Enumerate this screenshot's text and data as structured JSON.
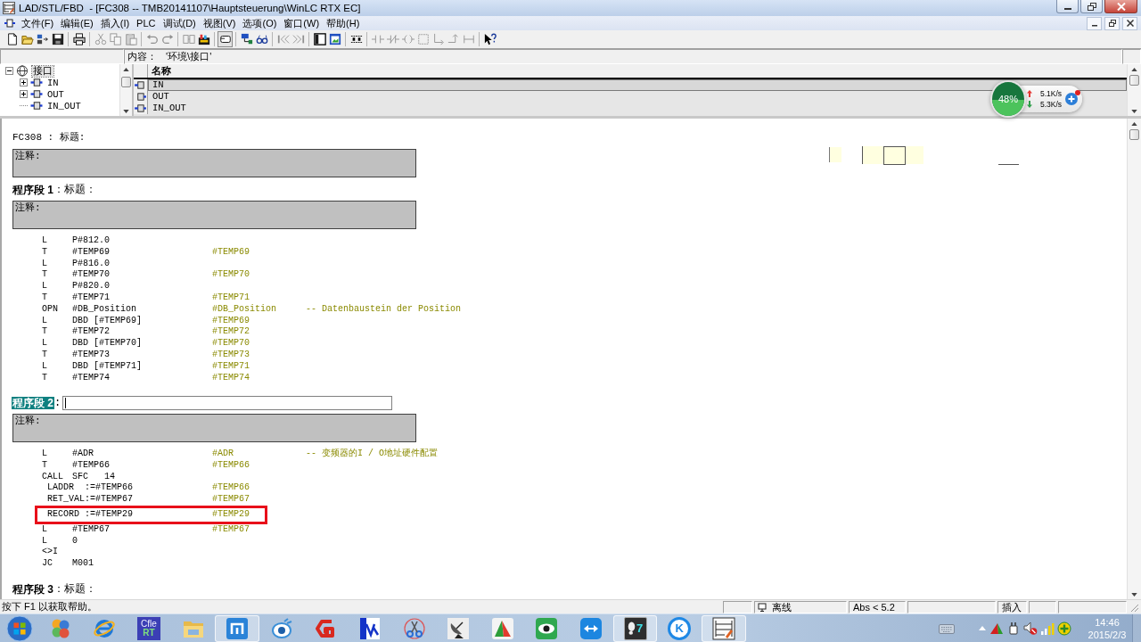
{
  "window": {
    "title": "LAD/STL/FBD  - [FC308 -- TMB20141107\\Hauptsteuerung\\WinLC RTX EC]"
  },
  "menu": [
    "文件(F)",
    "编辑(E)",
    "插入(I)",
    "PLC",
    "调试(D)",
    "视图(V)",
    "选项(O)",
    "窗口(W)",
    "帮助(H)"
  ],
  "toolbar": [
    [
      {
        "disabled": false,
        "pressed": false
      },
      {
        "disabled": false,
        "pressed": false
      },
      {
        "disabled": false,
        "pressed": false
      },
      {
        "disabled": false,
        "pressed": false
      }
    ],
    [
      {
        "disabled": false,
        "pressed": false
      }
    ],
    [
      {
        "disabled": true,
        "pressed": false
      },
      {
        "disabled": true,
        "pressed": false
      },
      {
        "disabled": true,
        "pressed": false
      }
    ],
    [
      {
        "disabled": true,
        "pressed": false
      },
      {
        "disabled": true,
        "pressed": false
      }
    ],
    [
      {
        "disabled": true,
        "pressed": false
      },
      {
        "disabled": false,
        "pressed": false
      }
    ],
    [
      {
        "disabled": false,
        "pressed": true
      }
    ],
    [
      {
        "disabled": false,
        "pressed": false
      },
      {
        "disabled": false,
        "pressed": false
      }
    ],
    [
      {
        "disabled": true,
        "pressed": false
      },
      {
        "disabled": true,
        "pressed": false
      }
    ],
    [
      {
        "disabled": false,
        "pressed": false
      },
      {
        "disabled": false,
        "pressed": false
      }
    ],
    [
      {
        "disabled": false,
        "pressed": false
      }
    ],
    [
      {
        "disabled": true,
        "pressed": false
      },
      {
        "disabled": true,
        "pressed": false
      },
      {
        "disabled": true,
        "pressed": false
      },
      {
        "disabled": true,
        "pressed": false
      },
      {
        "disabled": true,
        "pressed": false
      },
      {
        "disabled": true,
        "pressed": false
      },
      {
        "disabled": true,
        "pressed": false
      }
    ],
    [
      {
        "disabled": false,
        "pressed": false
      }
    ]
  ],
  "interface_pane": {
    "content_label": "内容：",
    "content_path": "'环境\\接口'",
    "tree": [
      {
        "label": "接口",
        "expanded": true,
        "selected": true,
        "children": [
          {
            "label": "IN",
            "expanded": false,
            "selected": false
          },
          {
            "label": "OUT",
            "expanded": false,
            "selected": false
          },
          {
            "label": "IN_OUT",
            "selected": false
          }
        ]
      }
    ],
    "table": {
      "columns": [
        "名称"
      ],
      "rows": [
        {
          "name": "IN",
          "selected": true
        },
        {
          "name": "OUT",
          "selected": false
        },
        {
          "name": "IN_OUT",
          "selected": false
        }
      ]
    }
  },
  "speed_widget": {
    "percent": "48%",
    "level": 0.48,
    "upload": "5.1K/s",
    "download": "5.3K/s",
    "notification": true
  },
  "editor": {
    "block_title": "FC308 : 标题:",
    "block_comment": "注释:",
    "networks": [
      {
        "heading": "程序段 1",
        "title": "：标题：",
        "editing": false,
        "comment": "注释:",
        "lines": [
          {
            "kind": "instr",
            "op": "L",
            "operand": "P#812.0",
            "framed": false
          },
          {
            "kind": "instr",
            "op": "T",
            "operand": "#TEMP69",
            "symbol": "#TEMP69",
            "framed": false
          },
          {
            "kind": "instr",
            "op": "L",
            "operand": "P#816.0",
            "framed": false
          },
          {
            "kind": "instr",
            "op": "T",
            "operand": "#TEMP70",
            "symbol": "#TEMP70",
            "framed": false
          },
          {
            "kind": "instr",
            "op": "L",
            "operand": "P#820.0",
            "framed": false
          },
          {
            "kind": "instr",
            "op": "T",
            "operand": "#TEMP71",
            "symbol": "#TEMP71",
            "framed": false
          },
          {
            "kind": "instr",
            "op": "OPN",
            "operand": "#DB_Position",
            "symbol": "#DB_Position",
            "comment": "-- Datenbaustein der Position",
            "framed": false
          },
          {
            "kind": "instr",
            "op": "L",
            "operand": "DBD [#TEMP69]",
            "symbol": "#TEMP69",
            "framed": false
          },
          {
            "kind": "instr",
            "op": "T",
            "operand": "#TEMP72",
            "symbol": "#TEMP72",
            "framed": false
          },
          {
            "kind": "instr",
            "op": "L",
            "operand": "DBD [#TEMP70]",
            "symbol": "#TEMP70",
            "framed": false
          },
          {
            "kind": "instr",
            "op": "T",
            "operand": "#TEMP73",
            "symbol": "#TEMP73",
            "framed": false
          },
          {
            "kind": "instr",
            "op": "L",
            "operand": "DBD [#TEMP71]",
            "symbol": "#TEMP71",
            "framed": false
          },
          {
            "kind": "instr",
            "op": "T",
            "operand": "#TEMP74",
            "symbol": "#TEMP74",
            "framed": false
          }
        ]
      },
      {
        "heading": "程序段 2",
        "title": ":",
        "editing": true,
        "comment": "注释:",
        "lines": [
          {
            "kind": "instr",
            "op": "L",
            "operand": "#ADR",
            "symbol": "#ADR",
            "comment": "-- 变频器的I / O地址硬件配置",
            "framed": false
          },
          {
            "kind": "instr",
            "op": "T",
            "operand": "#TEMP66",
            "symbol": "#TEMP66",
            "framed": false
          },
          {
            "kind": "instr",
            "op": "CALL",
            "operand": "SFC   14",
            "framed": false
          },
          {
            "kind": "param",
            "text": "LADDR  :=#TEMP66",
            "symbol": "#TEMP66",
            "framed": false
          },
          {
            "kind": "param",
            "text": "RET_VAL:=#TEMP67",
            "symbol": "#TEMP67",
            "framed": false
          },
          {
            "kind": "param",
            "text": "RECORD :=#TEMP29",
            "symbol": "#TEMP29",
            "framed": true
          },
          {
            "kind": "instr",
            "op": "L",
            "operand": "#TEMP67",
            "symbol": "#TEMP67",
            "framed": false
          },
          {
            "kind": "instr",
            "op": "L",
            "operand": "0",
            "framed": false
          },
          {
            "kind": "instr",
            "op": "<>I",
            "framed": false
          },
          {
            "kind": "instr",
            "op": "JC",
            "operand": "M001",
            "framed": false
          }
        ]
      },
      {
        "heading": "程序段 3",
        "title": "：标题：",
        "editing": false
      }
    ]
  },
  "status_bar": {
    "help_text": "按下 F1 以获取帮助。",
    "panels": [
      {
        "kind": "blank"
      },
      {
        "kind": "connection",
        "text": "离线"
      },
      {
        "kind": "text",
        "text": "Abs < 5.2"
      },
      {
        "kind": "blank"
      },
      {
        "kind": "text",
        "text": "插入"
      },
      {
        "kind": "blank"
      },
      {
        "kind": "blank"
      }
    ]
  },
  "taskbar": {
    "items": [
      {
        "active": false
      },
      {
        "active": false
      },
      {
        "active": false,
        "label": "Cfle",
        "sublabel": "RT"
      },
      {
        "active": false
      },
      {
        "active": true
      },
      {
        "active": false
      },
      {
        "active": false
      },
      {
        "active": false
      },
      {
        "active": false
      },
      {
        "active": false
      },
      {
        "active": false
      },
      {
        "active": false
      },
      {
        "active": false
      },
      {
        "active": true,
        "label": "7"
      },
      {
        "active": false,
        "label": "K"
      },
      {
        "active": true
      }
    ],
    "clock": {
      "time": "14:46",
      "date": "2015/2/3"
    }
  }
}
